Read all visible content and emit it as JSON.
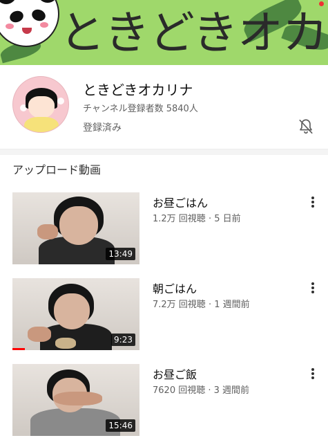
{
  "banner": {
    "title": "ときどきオカリナ"
  },
  "channel": {
    "name": "ときどきオカリナ",
    "subscribers": "チャンネル登録者数 5840人",
    "status": "登録済み"
  },
  "section": {
    "title": "アップロード動画"
  },
  "videos": [
    {
      "title": "お昼ごはん",
      "meta": "1.2万 回視聴 · 5 日前",
      "duration": "13:49",
      "progress": 0
    },
    {
      "title": "朝ごはん",
      "meta": "7.2万 回視聴 · 1 週間前",
      "duration": "9:23",
      "progress": 0.1
    },
    {
      "title": "お昼ご飯",
      "meta": "7620 回視聴 · 3 週間前",
      "duration": "15:46",
      "progress": 0
    }
  ],
  "icons": {
    "bell": "bell-off-icon",
    "more": "more-vert-icon"
  },
  "colors": {
    "banner": "#9fd86b",
    "progress": "#ff0000",
    "meta": "#606060"
  }
}
